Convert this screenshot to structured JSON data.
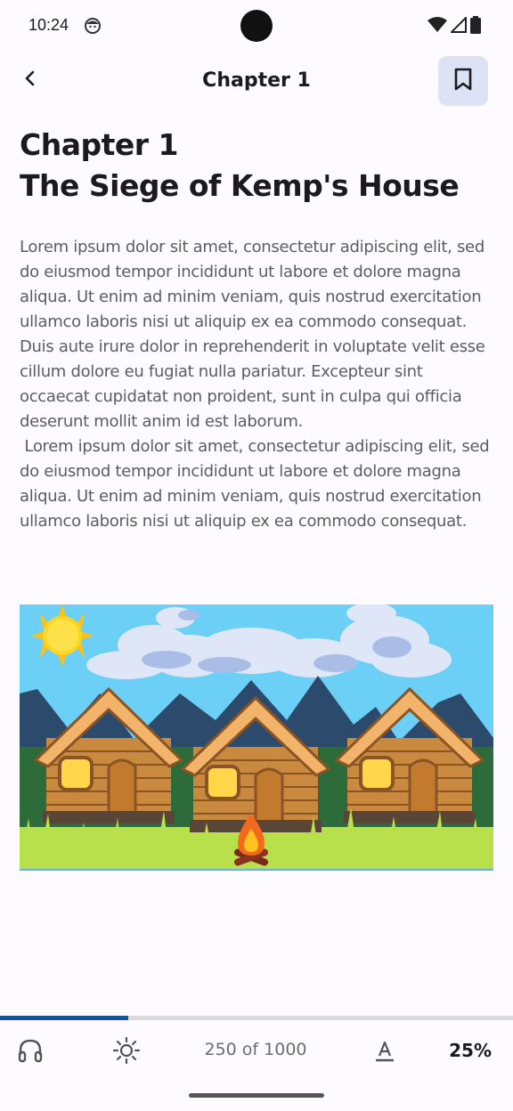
{
  "status": {
    "time": "10:24"
  },
  "header": {
    "title": "Chapter 1",
    "back_icon": "back-arrow-icon",
    "bookmark_icon": "bookmark-icon"
  },
  "chapter": {
    "heading": "Chapter 1\nThe Siege of Kemp's House",
    "text": "Lorem ipsum dolor sit amet, consectetur adipiscing elit, sed do eiusmod tempor incididunt ut labore et dolore magna aliqua. Ut enim ad minim veniam, quis nostrud exercitation ullamco laboris nisi ut aliquip ex ea commodo consequat. Duis aute irure dolor in reprehenderit in voluptate velit esse cillum dolore eu fugiat nulla pariatur. Excepteur sint occaecat cupidatat non proident, sunt in culpa qui officia deserunt mollit anim id est laborum.\n Lorem ipsum dolor sit amet, consectetur adipiscing elit, sed do eiusmod tempor incididunt ut labore et dolore magna aliqua. Ut enim ad minim veniam, quis nostrud exercitation ullamco laboris nisi ut aliquip ex ea commodo consequat."
  },
  "reader": {
    "progress_fraction": 0.25,
    "page_count": "250 of 1000",
    "percent": "25%",
    "icons": [
      "headphones-icon",
      "brightness-icon",
      "text-format-icon"
    ]
  },
  "colors": {
    "accent": "#0b57a8",
    "bookmark_bg": "#dde3f5",
    "sky": "#6ccff6",
    "grass": "#b8e04a"
  }
}
